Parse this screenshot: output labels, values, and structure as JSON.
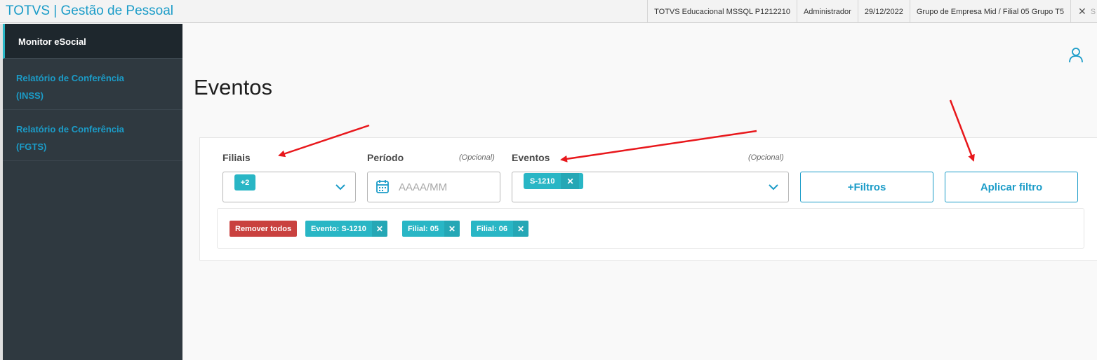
{
  "header": {
    "app_title": "TOTVS | Gestão de Pessoal",
    "system": "TOTVS Educacional MSSQL P1212210",
    "user": "Administrador",
    "date": "29/12/2022",
    "company": "Grupo de Empresa Mid / Filial 05 Grupo T5",
    "close_glyph": "✕",
    "cut_text": "S"
  },
  "sidebar": {
    "items": [
      {
        "label": "Monitor eSocial"
      },
      {
        "label_line1": "Relatório de Conferência",
        "label_line2": "(INSS)"
      },
      {
        "label_line1": "Relatório de Conferência",
        "label_line2": "(FGTS)"
      }
    ]
  },
  "page": {
    "title": "Eventos",
    "user_icon": "user-icon"
  },
  "filters": {
    "filiais": {
      "label": "Filiais",
      "chip": "+2"
    },
    "periodo": {
      "label": "Período",
      "optional": "(Opcional)",
      "placeholder": "AAAA/MM",
      "icon": "calendar-icon"
    },
    "eventos": {
      "label": "Eventos",
      "optional": "(Opcional)",
      "chip": "S-1210",
      "chip_close": "✕"
    },
    "more_filters": "+Filtros",
    "apply": "Aplicar filtro"
  },
  "active_tags": {
    "remove_all": "Remover todos",
    "tags": [
      {
        "label": "Evento: S-1210",
        "close": "✕"
      },
      {
        "label": "Filial: 05",
        "close": "✕"
      },
      {
        "label": "Filial: 06",
        "close": "✕"
      }
    ]
  },
  "colors": {
    "accent": "#1b9cc8",
    "chip": "#29b6c5",
    "danger": "#c9413f",
    "annotation": "#e8171b"
  }
}
